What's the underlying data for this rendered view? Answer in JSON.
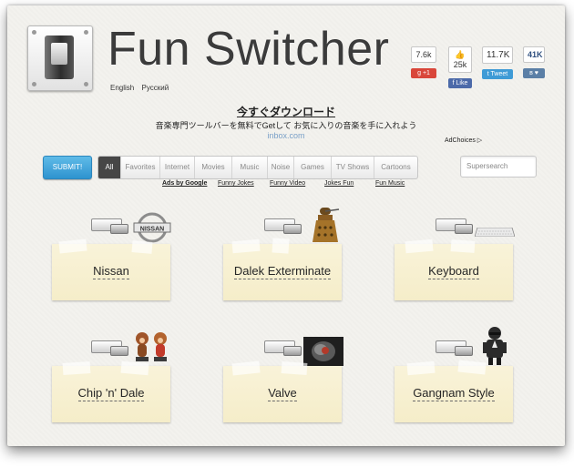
{
  "header": {
    "title": "Fun Switcher",
    "languages": [
      "English",
      "Русский"
    ]
  },
  "social": {
    "google_count": "7.6k",
    "google_label": "+1",
    "like_count": "25k",
    "like_label": "Like",
    "tweet_count": "11.7K",
    "tweet_label": "Tweet",
    "vk_count": "41K"
  },
  "promo": {
    "title": "今すぐダウンロード",
    "subtitle": "音楽専門ツールバーを無料でGetして お気に入りの音楽を手に入れよう",
    "link": "inbox.com",
    "adchoices": "AdChoices ▷"
  },
  "toolbar": {
    "submit_label": "SUBMIT!",
    "categories": [
      "All",
      "Favorites",
      "Internet",
      "Movies",
      "Music",
      "Noise",
      "Games",
      "TV Shows",
      "Cartoons"
    ],
    "search_placeholder": "Supersearch"
  },
  "adlinks": [
    "Ads by Google",
    "Funny Jokes",
    "Funny Video",
    "Jokes Fun",
    "Fun Music"
  ],
  "cards": [
    {
      "label": "Nissan",
      "icon": "nissan-logo-icon"
    },
    {
      "label": "Dalek Exterminate",
      "icon": "dalek-icon"
    },
    {
      "label": "Keyboard",
      "icon": "keyboard-icon"
    },
    {
      "label": "Chip 'n' Dale",
      "icon": "chipmunks-icon"
    },
    {
      "label": "Valve",
      "icon": "valve-icon"
    },
    {
      "label": "Gangnam Style",
      "icon": "psy-icon"
    }
  ],
  "colors": {
    "accent_blue": "#3aa0d8",
    "active_tab": "#464646",
    "card_paper": "#f7f0d3"
  }
}
